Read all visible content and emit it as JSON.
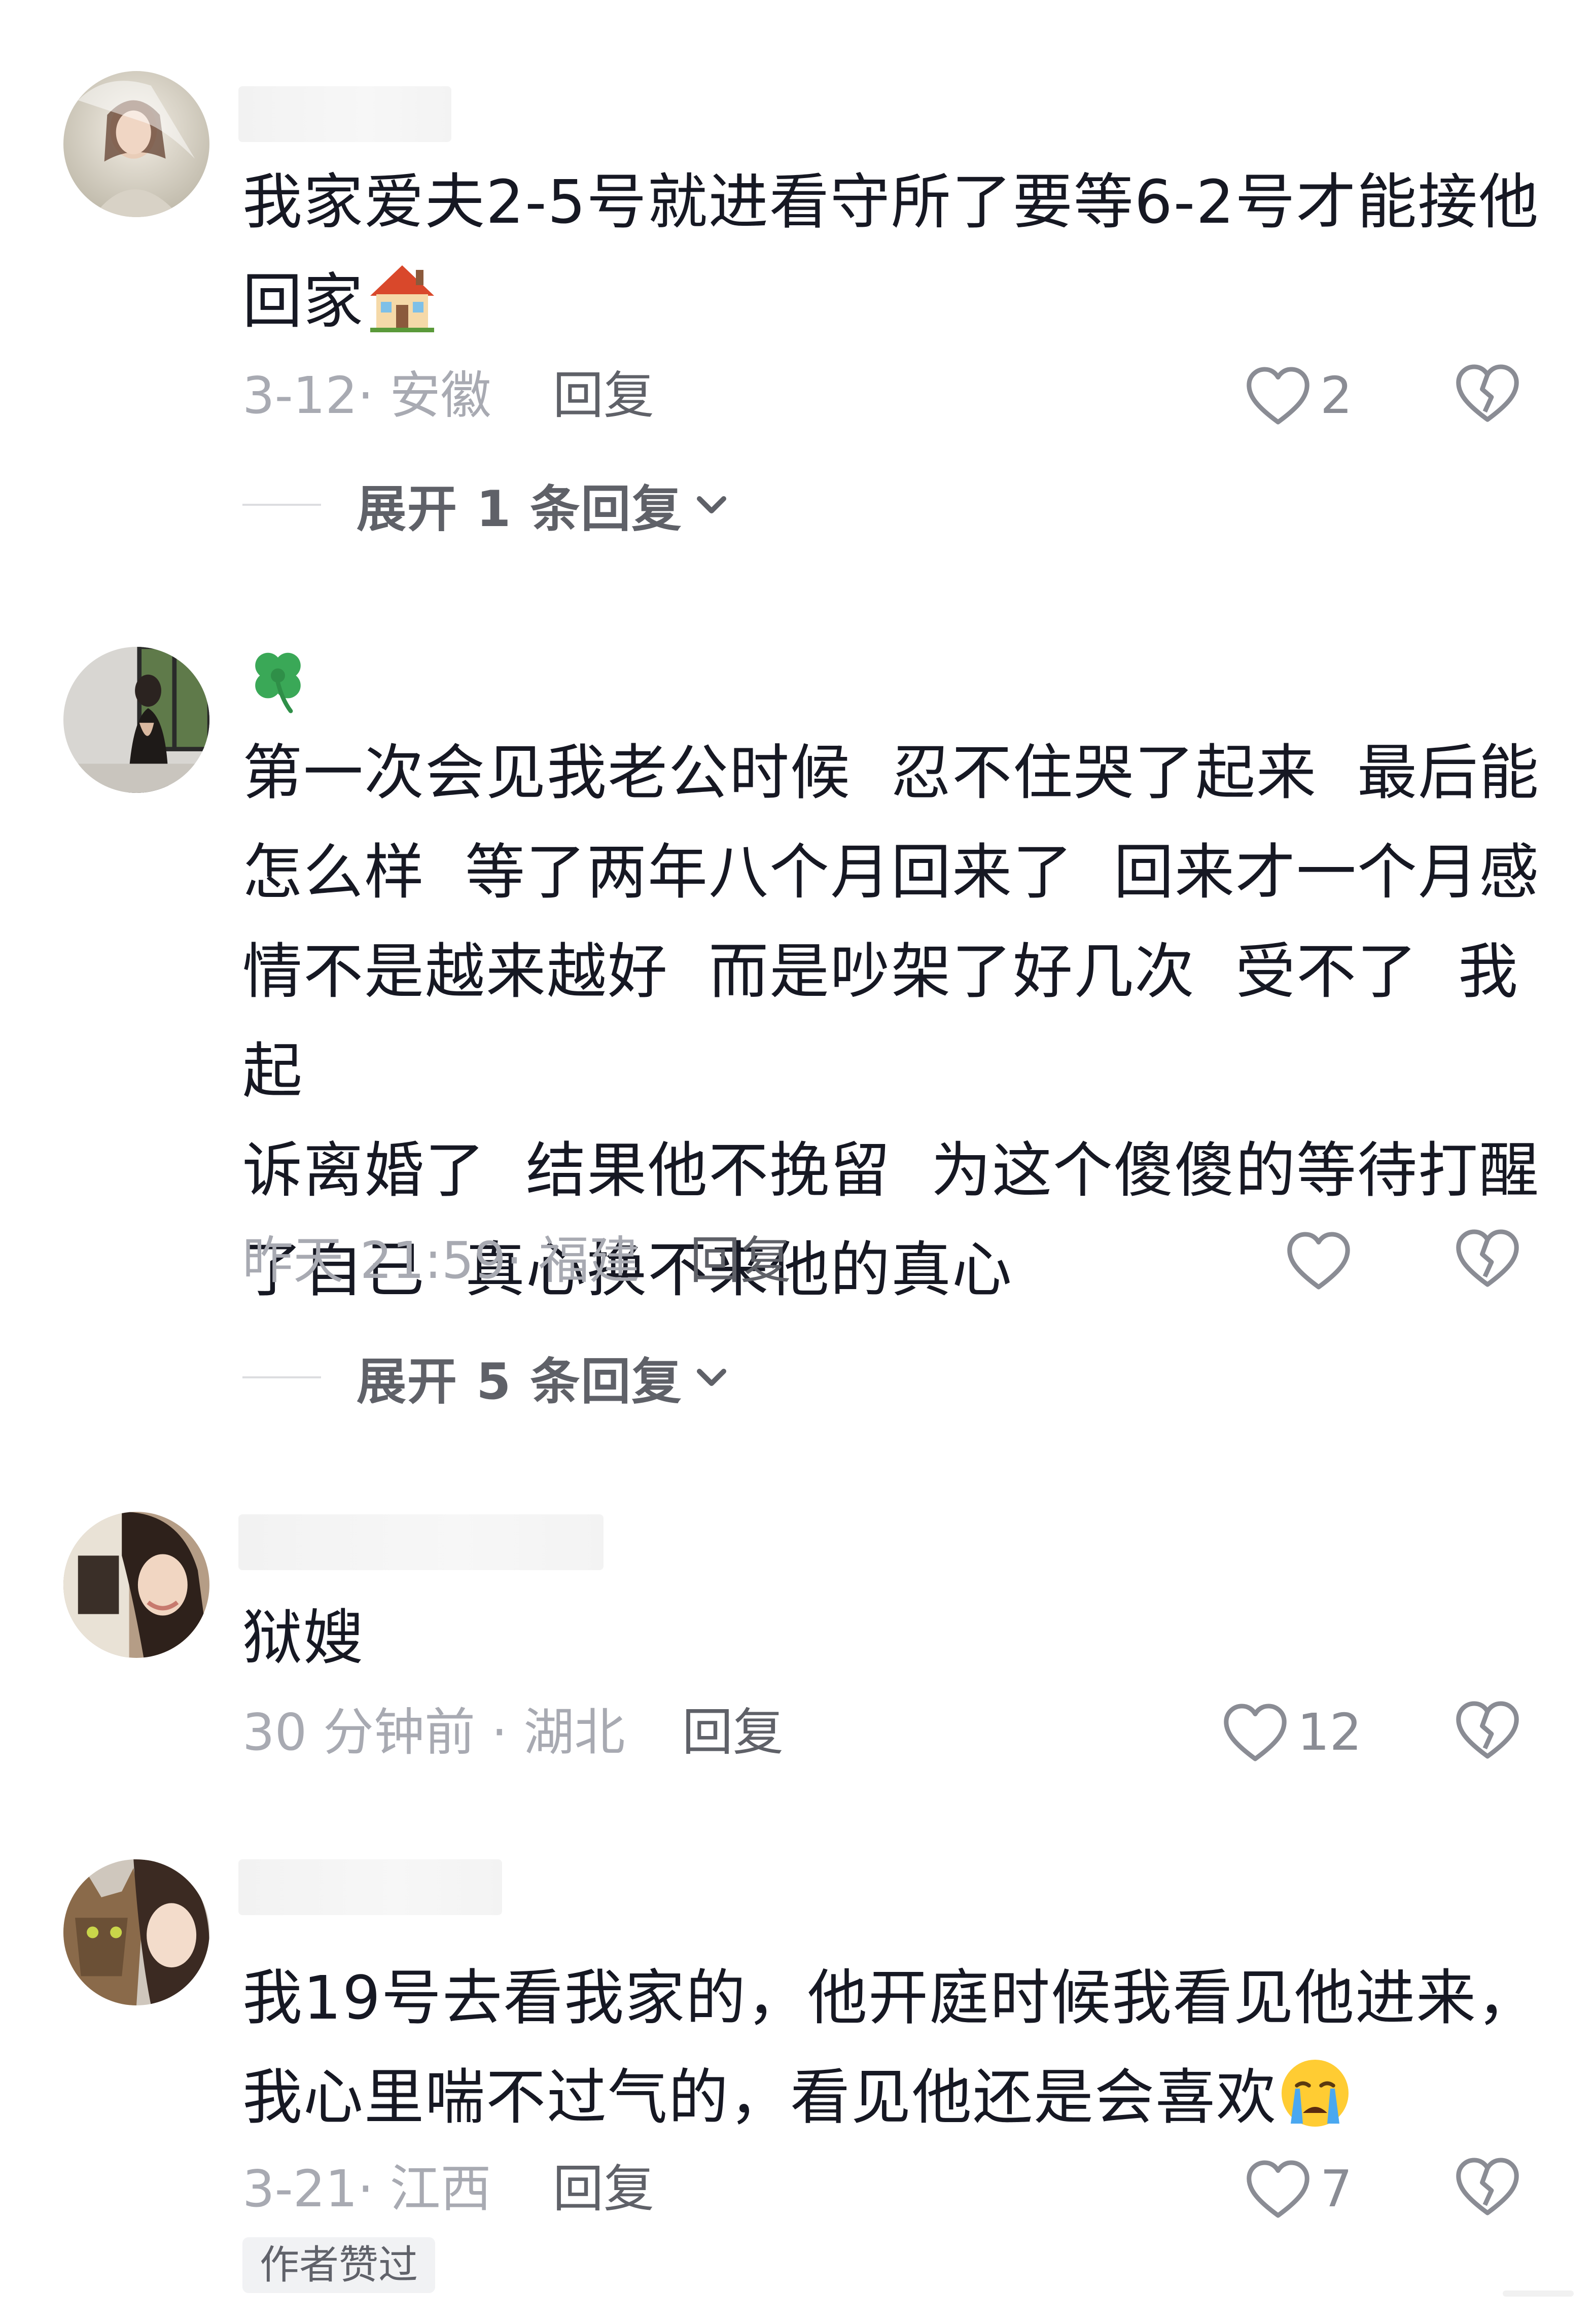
{
  "comments": [
    {
      "avatar": "avatar-woman-veil",
      "text": "我家爱夫2-5号就进看守所了要等6-2号才能接他\n回家",
      "text_emoji": "house-emoji",
      "date_location": "3-12· 安徽",
      "reply_label": "回复",
      "likes": "2",
      "expand_label": "展开 1 条回复"
    },
    {
      "avatar": "avatar-woman-window",
      "name_emoji": "four-leaf-clover-emoji",
      "text": "第一次会见我老公时候  忍不住哭了起来  最后能\n怎么样  等了两年八个月回来了  回来才一个月感\n情不是越来越好  而是吵架了好几次  受不了  我起\n诉离婚了  结果他不挽留  为这个傻傻的等待打醒\n了自己  真心换不来他的真心",
      "date_location": "昨天 21:59· 福建",
      "reply_label": "回复",
      "likes": "",
      "expand_label": "展开 5 条回复"
    },
    {
      "avatar": "avatar-woman-selfie",
      "text": "狱嫂",
      "date_location": "30 分钟前 · 湖北",
      "reply_label": "回复",
      "likes": "12"
    },
    {
      "avatar": "avatar-cat-girl",
      "text": "我19号去看我家的，他开庭时候我看见他进来，\n我心里喘不过气的，看见他还是会喜欢",
      "text_emoji": "crying-face-emoji",
      "date_location": "3-21· 江西",
      "reply_label": "回复",
      "likes": "7",
      "author_badge": "作者赞过"
    }
  ],
  "colors": {
    "text": "#161823",
    "meta": "#a8aab2",
    "reply": "#5f6168",
    "icon": "#8a8c94"
  }
}
